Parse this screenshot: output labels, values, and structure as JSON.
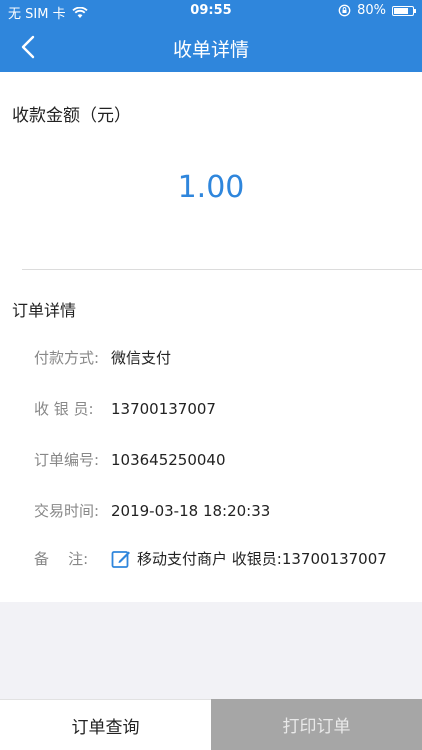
{
  "status_bar": {
    "carrier": "无 SIM 卡",
    "time": "09:55",
    "battery_text": "80%",
    "battery_level": 0.8
  },
  "nav": {
    "title": "收单详情",
    "back_icon": "chevron-left-icon"
  },
  "amount": {
    "label": "收款金额（元）",
    "value": "1.00"
  },
  "details": {
    "section_title": "订单详情",
    "rows": [
      {
        "label": "付款方式:",
        "value": "微信支付"
      },
      {
        "label": "收 银 员:",
        "value": "13700137007"
      },
      {
        "label": "订单编号:",
        "value": "103645250040"
      },
      {
        "label": "交易时间:",
        "value": "2019-03-18 18:20:33"
      },
      {
        "label": "备    注:",
        "value": "移动支付商户 收银员:13700137007"
      }
    ]
  },
  "bottom": {
    "query_label": "订单查询",
    "print_label": "打印订单"
  },
  "colors": {
    "accent": "#2f86dc",
    "print_button_bg": "#a6a6a6"
  }
}
